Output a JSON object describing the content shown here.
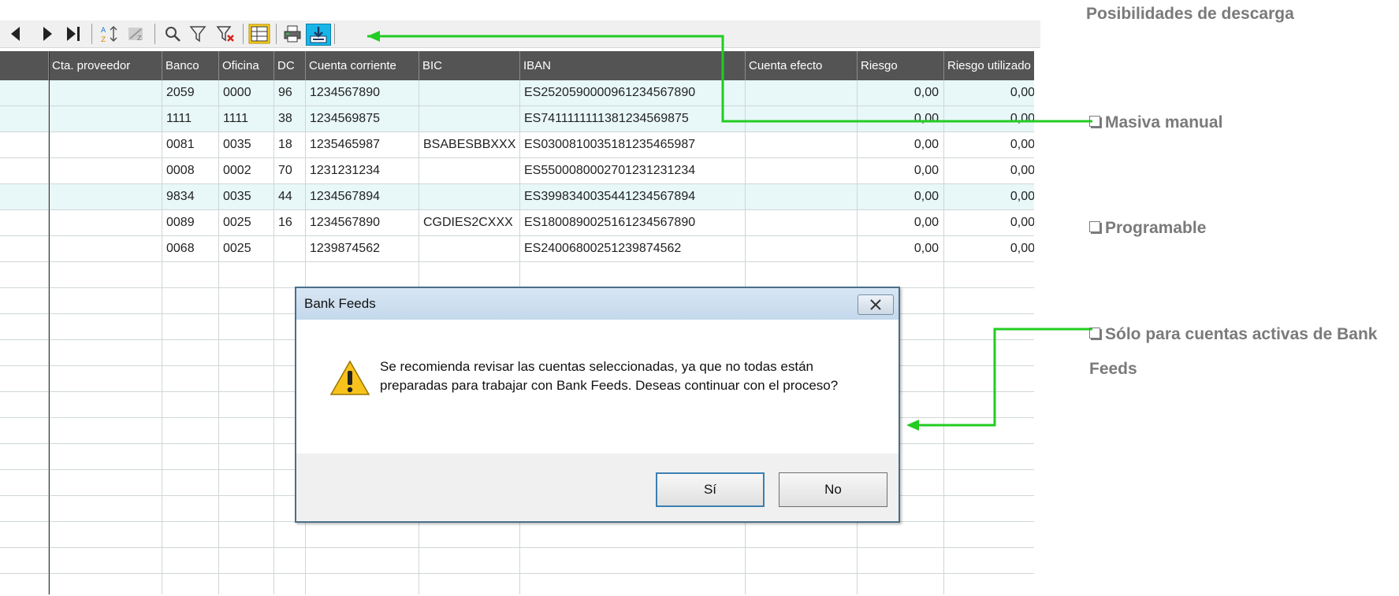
{
  "annotations": {
    "title": "Posibilidades de descarga",
    "items": [
      {
        "label": "Masiva manual"
      },
      {
        "label": "Programable"
      },
      {
        "label": "Sólo para cuentas activas de Bank Feeds"
      }
    ],
    "arrow_color": "#22cc22",
    "label_color": "#7a7a7a"
  },
  "toolbar": {
    "icons": [
      "prev-record-icon",
      "next-record-icon",
      "last-record-icon",
      "sort-az-icon",
      "sort-za-icon",
      "search-icon",
      "filter-icon",
      "clear-filter-icon",
      "grid-view-icon",
      "print-icon",
      "bank-feeds-download-icon"
    ],
    "highlight_color": "#18b6e8"
  },
  "grid": {
    "columns": [
      "Cta. proveedor",
      "Banco",
      "Oficina",
      "DC",
      "Cuenta corriente",
      "BIC",
      "IBAN",
      "Cuenta efecto",
      "Riesgo",
      "Riesgo utilizado"
    ],
    "rows": [
      {
        "banco": "2059",
        "oficina": "0000",
        "dc": "96",
        "cuenta": "1234567890",
        "bic": "",
        "iban": "ES2520590000961234567890",
        "riesgo": "0,00",
        "riesgo_util": "0,00",
        "highlight": true
      },
      {
        "banco": "1111",
        "oficina": "1111",
        "dc": "38",
        "cuenta": "1234569875",
        "bic": "",
        "iban": "ES7411111111381234569875",
        "riesgo": "0,00",
        "riesgo_util": "0,00",
        "highlight": true
      },
      {
        "banco": "0081",
        "oficina": "0035",
        "dc": "18",
        "cuenta": "1235465987",
        "bic": "BSABESBBXXX",
        "iban": "ES0300810035181235465987",
        "riesgo": "0,00",
        "riesgo_util": "0,00",
        "highlight": false
      },
      {
        "banco": "0008",
        "oficina": "0002",
        "dc": "70",
        "cuenta": "1231231234",
        "bic": "",
        "iban": "ES5500080002701231231234",
        "riesgo": "0,00",
        "riesgo_util": "0,00",
        "highlight": false
      },
      {
        "banco": "9834",
        "oficina": "0035",
        "dc": "44",
        "cuenta": "1234567894",
        "bic": "",
        "iban": "ES3998340035441234567894",
        "riesgo": "0,00",
        "riesgo_util": "0,00",
        "highlight": true
      },
      {
        "banco": "0089",
        "oficina": "0025",
        "dc": "16",
        "cuenta": "1234567890",
        "bic": "CGDIES2CXXX",
        "iban": "ES1800890025161234567890",
        "riesgo": "0,00",
        "riesgo_util": "0,00",
        "highlight": false
      },
      {
        "banco": "0068",
        "oficina": "0025",
        "dc": "",
        "cuenta": "1239874562",
        "bic": "",
        "iban": "ES2400680025123987456​2",
        "riesgo": "0,00",
        "riesgo_util": "0,00",
        "highlight": false
      }
    ],
    "header_bg": "#545454",
    "row_highlight": "#e8f7f8"
  },
  "dialog": {
    "title": "Bank Feeds",
    "message": "Se recomienda revisar las cuentas seleccionadas, ya que no todas están preparadas para trabajar con Bank Feeds. Deseas continuar con el proceso?",
    "yes_label": "Sí",
    "no_label": "No",
    "close_icon": "close-icon",
    "warning_icon": "warning-icon"
  }
}
